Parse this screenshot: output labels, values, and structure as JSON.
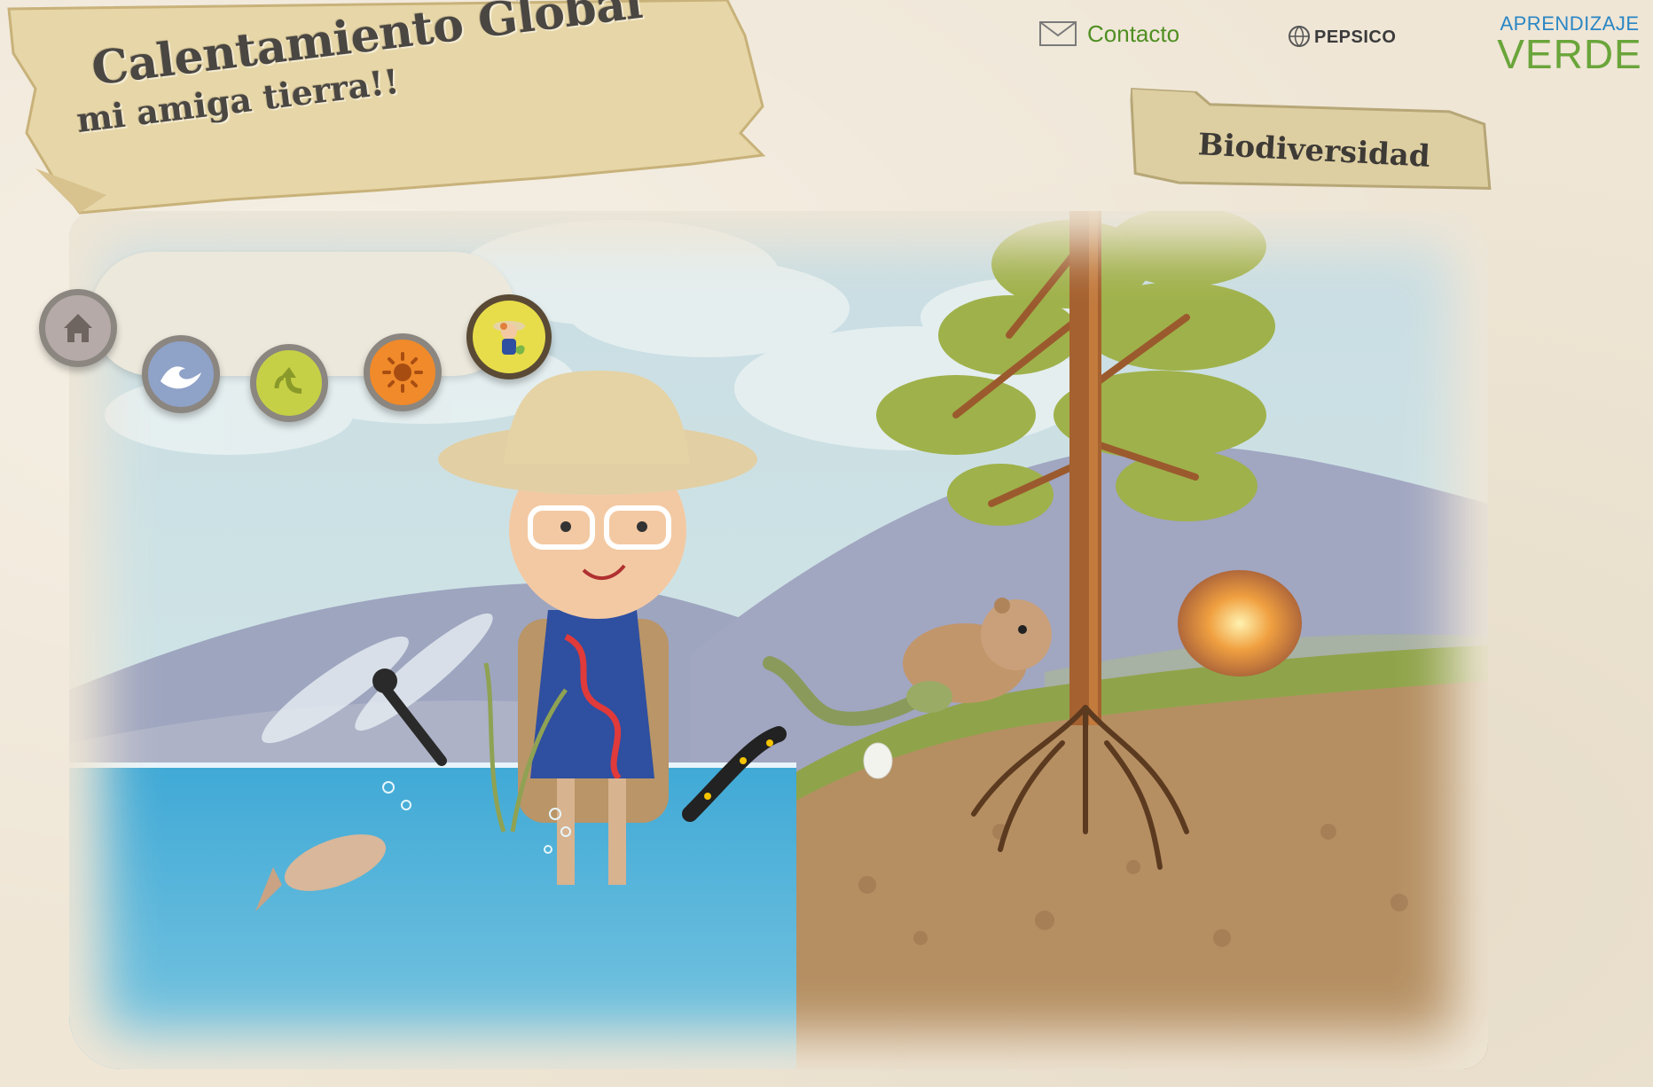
{
  "header": {
    "title": "Calentamiento Global",
    "subtitle": "mi amiga tierra!!",
    "contact_label": "Contacto",
    "pepsico_label": "PEPSICO",
    "aprendizaje_top": "APRENDIZAJE",
    "aprendizaje_bottom": "VERDE"
  },
  "section": {
    "label": "Biodiversidad"
  },
  "nav": {
    "items": [
      {
        "icon": "house-icon",
        "color": "#b5aaa7",
        "active": false
      },
      {
        "icon": "water-wave-icon",
        "color": "#8fa2c8",
        "active": false
      },
      {
        "icon": "recycle-icon",
        "color": "#c6d046",
        "active": false
      },
      {
        "icon": "sun-icon",
        "color": "#f08a2a",
        "active": false
      },
      {
        "icon": "explorer-girl-icon",
        "color": "#e7dd4a",
        "active": true
      }
    ]
  },
  "colors": {
    "contact_green": "#4f8f22",
    "aprendizaje_blue": "#2a86c4",
    "verde_green": "#6aa53a",
    "title_text": "#4a4642"
  }
}
